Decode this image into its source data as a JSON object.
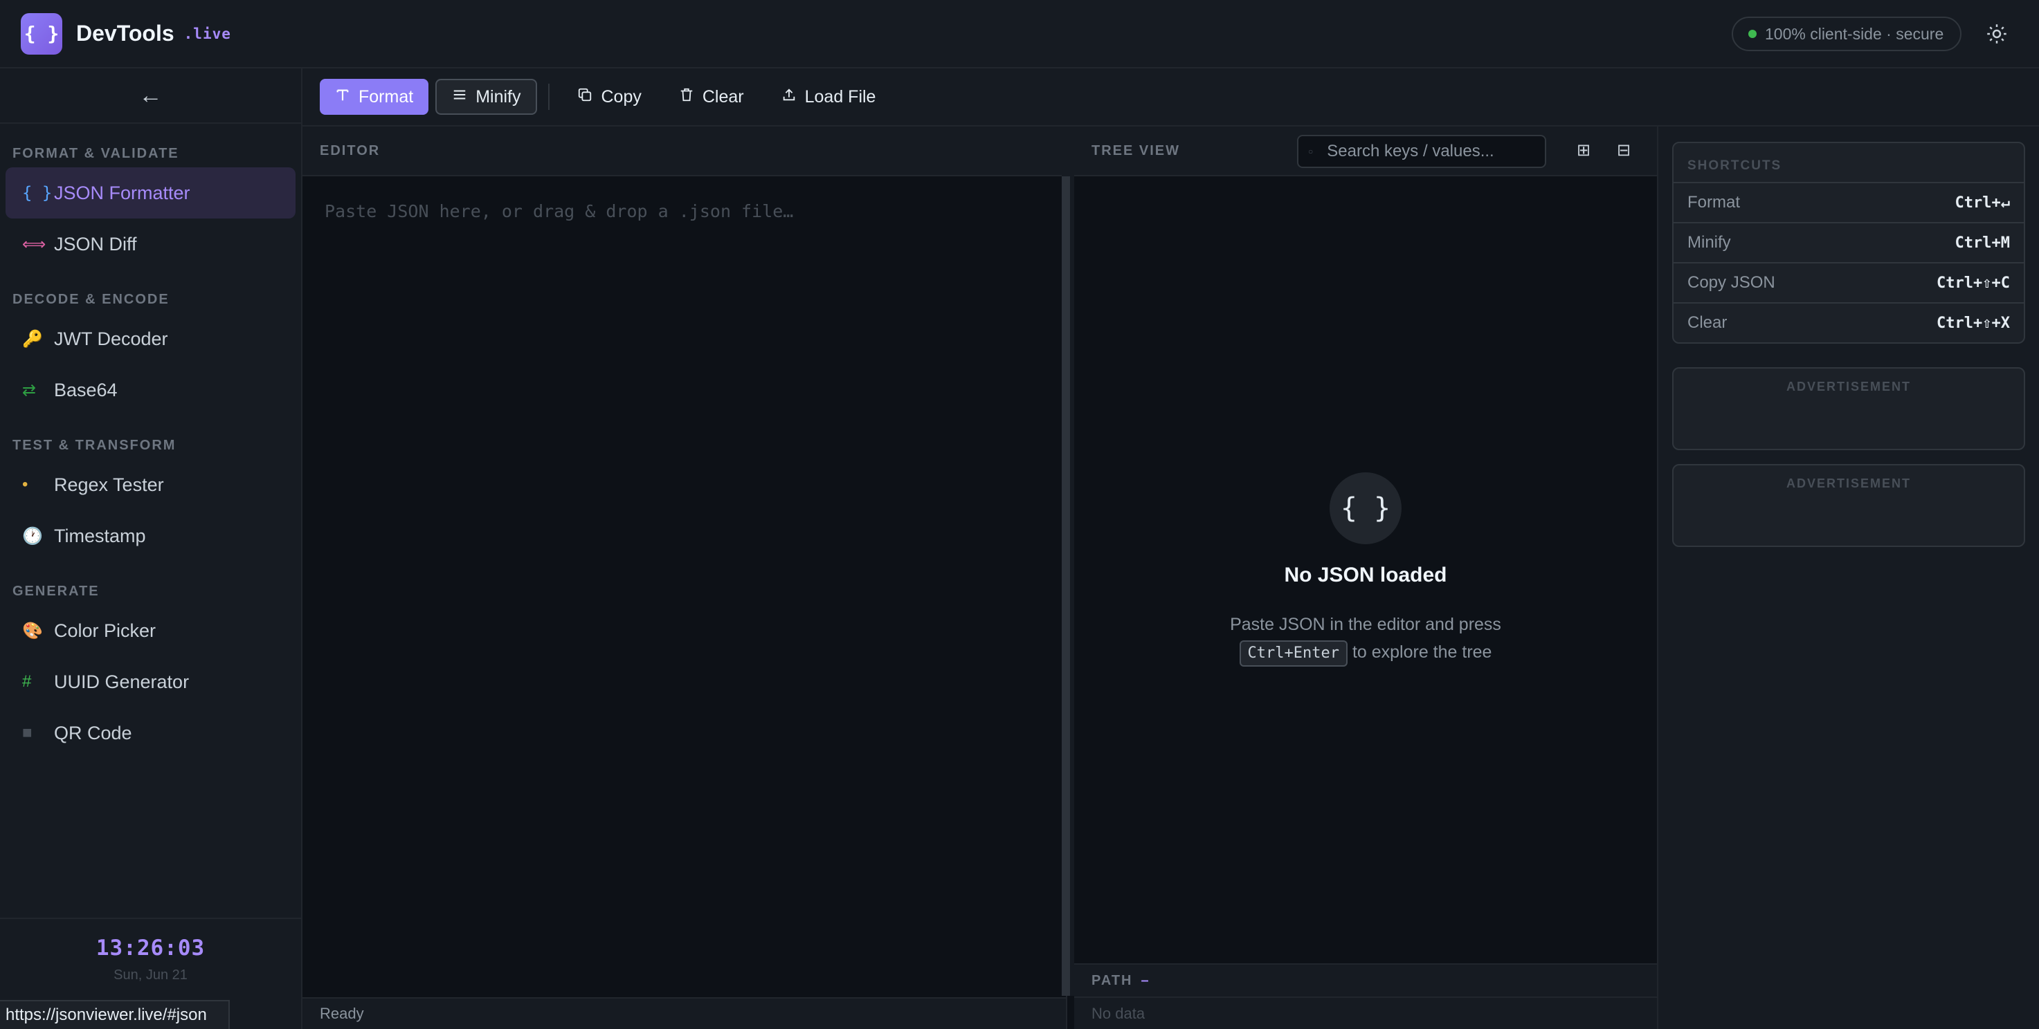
{
  "header": {
    "logo_glyph": "{ }",
    "brand": "DevTools",
    "tld": ".live",
    "secure_label": "100% client-side · secure",
    "theme_icon": "sun-icon"
  },
  "sidebar": {
    "collapse_glyph": "←",
    "sections": [
      {
        "title": "FORMAT & VALIDATE",
        "items": [
          {
            "label": "JSON Formatter",
            "icon": "{ }",
            "icon_name": "braces-icon",
            "color": "#58a6ff",
            "active": true
          },
          {
            "label": "JSON Diff",
            "icon": "⟺",
            "icon_name": "diff-icon",
            "color": "#db61a2"
          }
        ]
      },
      {
        "title": "DECODE & ENCODE",
        "items": [
          {
            "label": "JWT Decoder",
            "icon": "🔑",
            "icon_name": "key-icon",
            "color": "#d29922"
          },
          {
            "label": "Base64",
            "icon": "⇄",
            "icon_name": "swap-icon",
            "color": "#2ea043"
          }
        ]
      },
      {
        "title": "TEST & TRANSFORM",
        "items": [
          {
            "label": "Regex Tester",
            "icon": "•",
            "icon_name": "regex-icon",
            "color": "#e3b341"
          },
          {
            "label": "Timestamp",
            "icon": "🕐",
            "icon_name": "clock-icon",
            "color": "#c9d1d9"
          }
        ]
      },
      {
        "title": "GENERATE",
        "items": [
          {
            "label": "Color Picker",
            "icon": "🎨",
            "icon_name": "palette-icon",
            "color": "#f0883e"
          },
          {
            "label": "UUID Generator",
            "icon": "#",
            "icon_name": "hash-icon",
            "color": "#3fb950"
          },
          {
            "label": "QR Code",
            "icon": "■",
            "icon_name": "qr-icon",
            "color": "#484f58"
          }
        ]
      }
    ],
    "clock": "13:26:03",
    "date": "Sun, Jun 21"
  },
  "url_tip": "https://jsonviewer.live/#json",
  "toolbar": {
    "format": "Format",
    "minify": "Minify",
    "copy": "Copy",
    "clear": "Clear",
    "load": "Load File"
  },
  "editor": {
    "title": "EDITOR",
    "placeholder": "Paste JSON here, or drag & drop a .json file…",
    "status": "Ready"
  },
  "tree": {
    "title": "TREE VIEW",
    "search_placeholder": "Search keys / values...",
    "expand_glyph": "⊞",
    "collapse_glyph": "⊟",
    "empty_icon": "{ }",
    "empty_title": "No JSON loaded",
    "empty_line1": "Paste JSON in the editor and press",
    "empty_kbd": "Ctrl+Enter",
    "empty_line2": "to explore the tree",
    "path_label": "PATH",
    "path_value": "–",
    "no_data": "No data"
  },
  "shortcuts": {
    "title": "SHORTCUTS",
    "rows": [
      {
        "action": "Format",
        "keys": "Ctrl+↵"
      },
      {
        "action": "Minify",
        "keys": "Ctrl+M"
      },
      {
        "action": "Copy JSON",
        "keys": "Ctrl+⇧+C"
      },
      {
        "action": "Clear",
        "keys": "Ctrl+⇧+X"
      }
    ]
  },
  "ads": [
    "ADVERTISEMENT",
    "ADVERTISEMENT"
  ]
}
